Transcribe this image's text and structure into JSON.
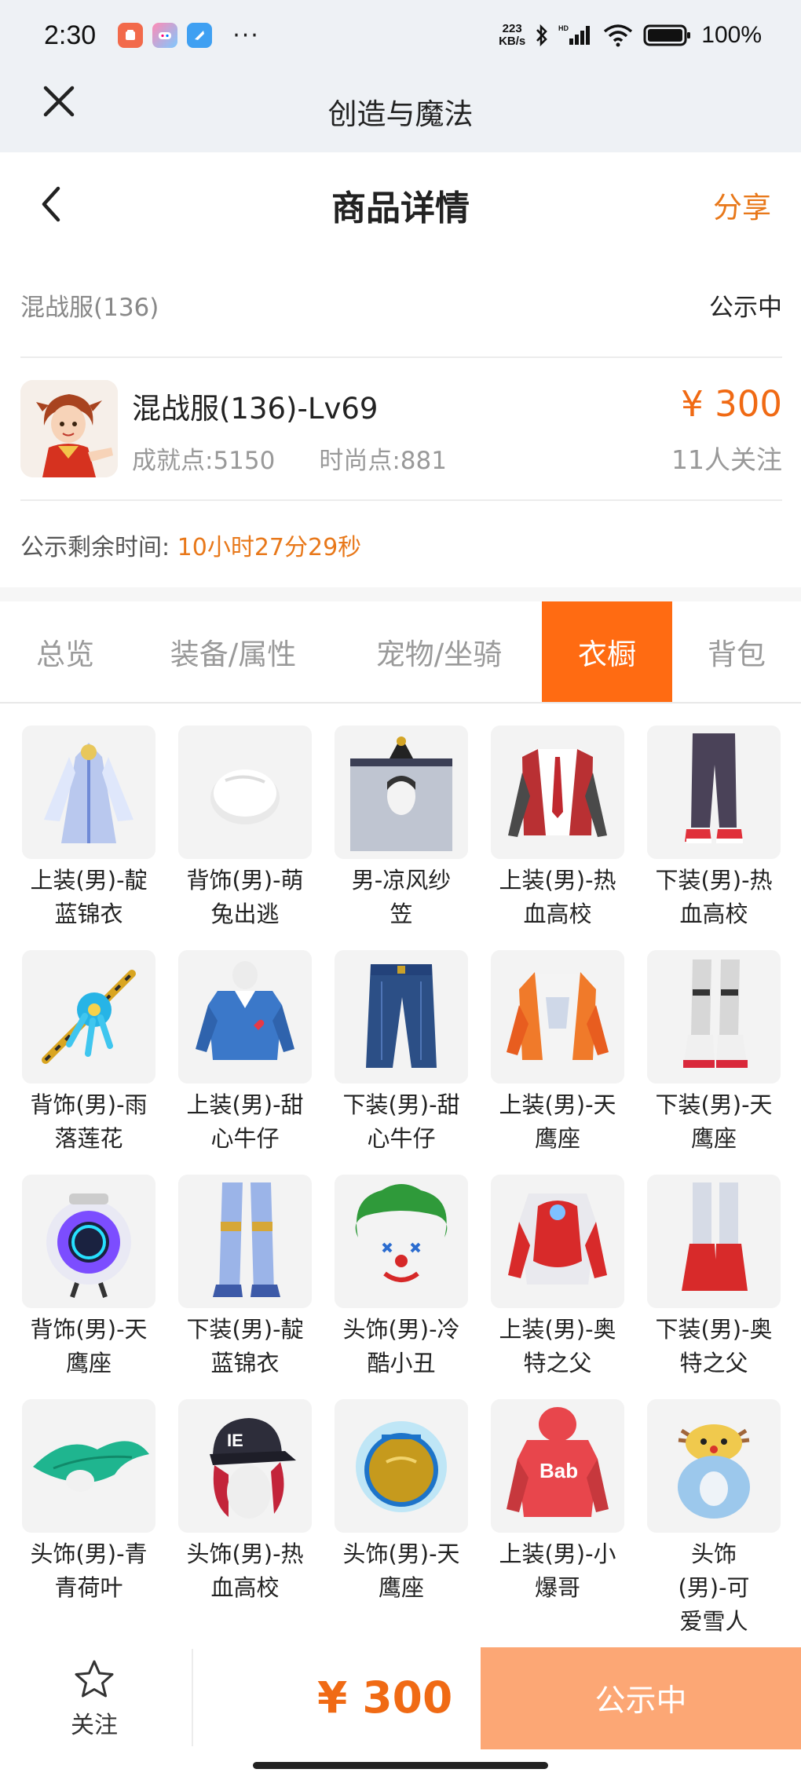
{
  "status_bar": {
    "time": "2:30",
    "dots": "···",
    "net_speed": "223",
    "net_unit": "KB/s",
    "battery": "100%"
  },
  "app_header": {
    "title": "创造与魔法"
  },
  "page_header": {
    "title": "商品详情",
    "share": "分享"
  },
  "listing": {
    "server": "混战服(136)",
    "status": "公示中",
    "name": "混战服(136)-Lv69",
    "achievement": "成就点:5150",
    "fashion": "时尚点:881",
    "price": "¥ 300",
    "watchers": "11人关注",
    "countdown_label": "公示剩余时间:",
    "countdown_value": "10小时27分29秒"
  },
  "tabs": [
    {
      "label": "总览"
    },
    {
      "label": "装备/属性"
    },
    {
      "label": "宠物/坐骑"
    },
    {
      "label": "衣橱"
    },
    {
      "label": "背包"
    }
  ],
  "active_tab": "衣橱",
  "wardrobe": [
    {
      "name": "上装(男)-靛蓝锦衣",
      "lines": [
        "上装(男)-靛",
        "蓝锦衣"
      ],
      "icon": "robe-icon",
      "color": "#b9c8ee"
    },
    {
      "name": "背饰(男)-萌兔出逃",
      "lines": [
        "背饰(男)-萌",
        "兔出逃"
      ],
      "icon": "bunny-icon",
      "color": "#ffffff"
    },
    {
      "name": "男-凉风纱笠",
      "lines": [
        "男-凉风纱",
        "笠"
      ],
      "icon": "veil-hat-icon",
      "color": "#aeb6c6"
    },
    {
      "name": "上装(男)-热血高校",
      "lines": [
        "上装(男)-热",
        "血高校"
      ],
      "icon": "school-jacket-icon",
      "color": "#b93033"
    },
    {
      "name": "下装(男)-热血高校",
      "lines": [
        "下装(男)-热",
        "血高校"
      ],
      "icon": "pants-icon",
      "color": "#4a4258"
    },
    {
      "name": "背饰(男)-雨落莲花",
      "lines": [
        "背饰(男)-雨",
        "落莲花"
      ],
      "icon": "flower-staff-icon",
      "color": "#27b4e6"
    },
    {
      "name": "上装(男)-甜心牛仔",
      "lines": [
        "上装(男)-甜",
        "心牛仔"
      ],
      "icon": "denim-shirt-icon",
      "color": "#3b78c9"
    },
    {
      "name": "下装(男)-甜心牛仔",
      "lines": [
        "下装(男)-甜",
        "心牛仔"
      ],
      "icon": "jeans-icon",
      "color": "#2c4f86"
    },
    {
      "name": "上装(男)-天鹰座",
      "lines": [
        "上装(男)-天",
        "鹰座"
      ],
      "icon": "armor-jacket-icon",
      "color": "#f07a2a"
    },
    {
      "name": "下装(男)-天鹰座",
      "lines": [
        "下装(男)-天",
        "鹰座"
      ],
      "icon": "boots-icon",
      "color": "#d7d7d7"
    },
    {
      "name": "背饰(男)-天鹰座",
      "lines": [
        "背饰(男)-天",
        "鹰座"
      ],
      "icon": "mech-pack-icon",
      "color": "#7c4dff"
    },
    {
      "name": "下装(男)-靛蓝锦衣",
      "lines": [
        "下装(男)-靛",
        "蓝锦衣"
      ],
      "icon": "armored-legs-icon",
      "color": "#9bb4e8"
    },
    {
      "name": "头饰(男)-冷酷小丑",
      "lines": [
        "头饰(男)-冷",
        "酷小丑"
      ],
      "icon": "clown-mask-icon",
      "color": "#2f9a3a"
    },
    {
      "name": "上装(男)-奥特之父",
      "lines": [
        "上装(男)-奥",
        "特之父"
      ],
      "icon": "hero-suit-icon",
      "color": "#d82a2a"
    },
    {
      "name": "下装(男)-奥特之父",
      "lines": [
        "下装(男)-奥",
        "特之父"
      ],
      "icon": "hero-boots-icon",
      "color": "#d82a2a"
    },
    {
      "name": "头饰(男)-青青荷叶",
      "lines": [
        "头饰(男)-青",
        "青荷叶"
      ],
      "icon": "leaf-hat-icon",
      "color": "#1fb58f"
    },
    {
      "name": "头饰(男)-热血高校",
      "lines": [
        "头饰(男)-热",
        "血高校"
      ],
      "icon": "cap-icon",
      "color": "#c3243a"
    },
    {
      "name": "头饰(男)-天鹰座",
      "lines": [
        "头饰(男)-天",
        "鹰座"
      ],
      "icon": "helmet-icon",
      "color": "#c69a1d"
    },
    {
      "name": "上装(男)-小爆哥",
      "lines": [
        "上装(男)-小",
        "爆哥"
      ],
      "icon": "hoodie-icon",
      "color": "#e8464c"
    },
    {
      "name": "头饰(男)-可爱雪人",
      "lines": [
        "头饰",
        "(男)-可",
        "爱雪人"
      ],
      "icon": "snowman-hat-icon",
      "color": "#9cc8ec"
    }
  ],
  "bottom_bar": {
    "follow": "关注",
    "price": "¥ 300",
    "action": "公示中"
  },
  "colors": {
    "accent": "#ff6b12",
    "price": "#f06a14",
    "action_button": "#fca775",
    "header_bg": "#eef1f5"
  }
}
